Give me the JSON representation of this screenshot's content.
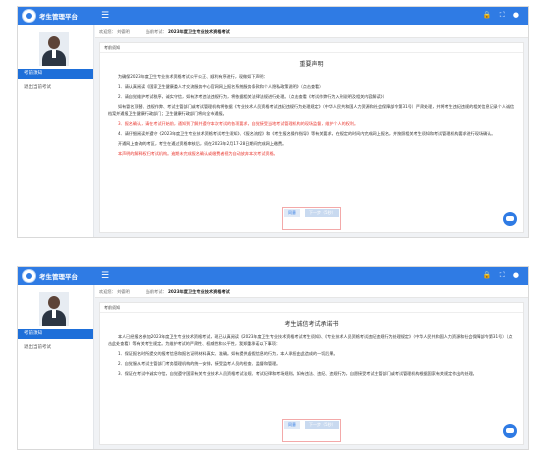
{
  "app": {
    "title": "考生管理平台",
    "menu_glyph": "☰",
    "top_icons": "🔒 ⛶ ●"
  },
  "sidebar": {
    "active_item": "考前须知",
    "second_item": "退出当前考试"
  },
  "breadcrumb": {
    "welcome": "欢迎您：  刘德明",
    "current_label": "当前考试：",
    "current_exam": "2023年度卫生专业技术资格考试"
  },
  "screens": [
    {
      "panel_header": "考前须知",
      "doc_title": "重要声明",
      "paragraphs": [
        {
          "text": "为确保2023年度卫生专业技术资格考试公平公正、顺利有序进行，现做如下声明：",
          "style": ""
        },
        {
          "text": "1．请认真阅读《国家卫生健康委人才交流服务中心官网网上报名系统服务条款和个人隐私政策说明》（点击查看）",
          "style": ""
        },
        {
          "text": "2．请自觉维护考试秩序，诚实守信，如有涉考违法违规行为，将依据相关法律法规进行处理。（点击查看《考试作弊行为入刑说明及相关内容解读》）",
          "style": ""
        },
        {
          "text": "如有冒名顶替、违规作弊、考试主管部门或考试管理机构将依据《专业技术人员资格考试违纪违规行为处理规定》（中华人民共和国人力资源和社会保障部令第31号）严肃处理，并将考生违纪违规的相关信息记录个人诚信档案并通报卫生健康行政部门；卫生健康行政部门将向全市通报。",
          "style": ""
        },
        {
          "text": "3．报名确认，请在考试开始前，通知到了解并遵守本次考试的各项要求，自觉接受当地考试管理机构的现场监督，维护个人的权利。",
          "style": "red"
        },
        {
          "text": "4．请仔细阅读并遵守《2023年度卫生专业技术资格考试考生须知》、《报名流程》和《考生报名操作指导》等有关要求，在规定的时间内完成网上报名，并按照相关考生须知和考试管理机构要求进行现场确认。",
          "style": ""
        },
        {
          "text": "开通网上查询的考区，考生在通过资格审核后，须在2023年2月17-28日期间完成网上缴费。",
          "style": "mixed"
        },
        {
          "text": "本声明的解释权归考试机构。逾期未完成报名确认或缴费者视为自动放弃本次考试资格。",
          "style": "red"
        }
      ],
      "mixed_red_part": "须在2023年2月17-28日期间完成网上缴费。",
      "buttons": {
        "primary": "同意",
        "secondary": "下一步（5秒）"
      }
    },
    {
      "panel_header": "考前须知",
      "doc_title": "考生诚信考试承诺书",
      "paragraphs": [
        {
          "text": "本人已经报名参加2023年度卫生专业技术资格考试，现已认真阅读《2023年度卫生专业技术资格考试考生须知》、《专业技术人员资格考试违纪违规行为处理规定》（中华人民共和国人力资源和社会保障部令第31号）（点击此处查看）等有关考生规定。为维护考试的严肃性、权威性和公平性，我郑重承诺以下事项：",
          "style": ""
        },
        {
          "text": "1．保证报名时所提交的报考信息和报名证明材料真实、准确。如有提供虚假信息的行为，本人承担由此造成的一切后果。",
          "style": ""
        },
        {
          "text": "2．自觉服从考试主管部门考务管理机构的统一安排，接受监考人员的检查、监督和管理。",
          "style": ""
        },
        {
          "text": "3．保证在考试中诚实守信，自觉遵守国家有关专业技术人员资格考试法规、考试纪律和考场规则。如有违法、违纪、违规行为，自愿接受考试主管部门或考试管理机构根据国家有关规定作出的处理。",
          "style": ""
        }
      ],
      "buttons": {
        "primary": "同意",
        "secondary": "下一步（5秒）"
      }
    }
  ]
}
